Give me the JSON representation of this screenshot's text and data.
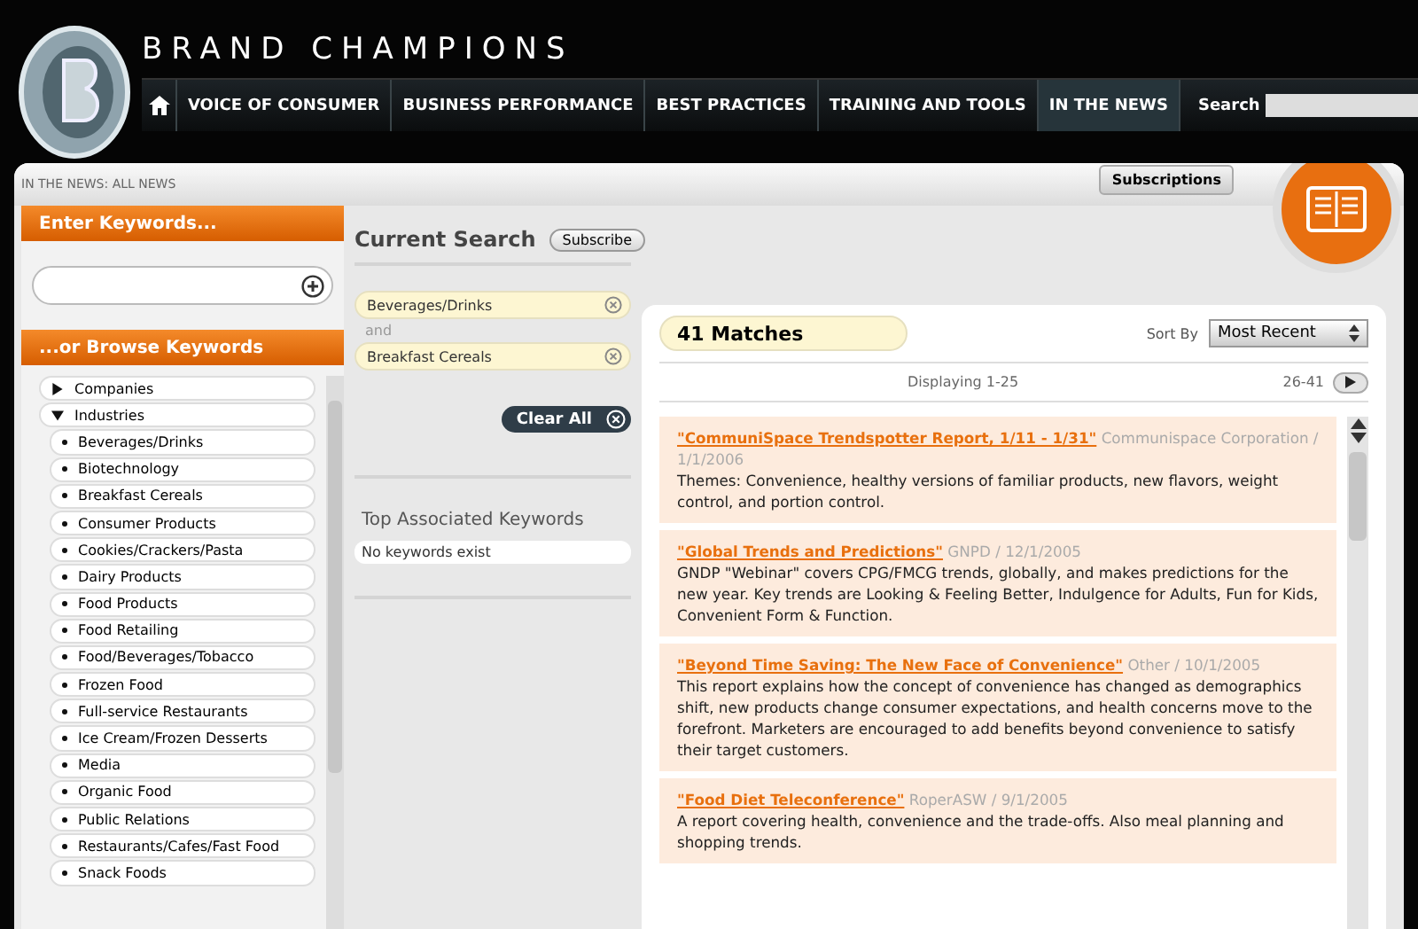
{
  "brand": {
    "name": "BRAND CHAMPIONS"
  },
  "nav": {
    "items": [
      {
        "label": "VOICE OF CONSUMER",
        "selected": false
      },
      {
        "label": "BUSINESS PERFORMANCE",
        "selected": false
      },
      {
        "label": "BEST PRACTICES",
        "selected": false
      },
      {
        "label": "TRAINING AND TOOLS",
        "selected": false
      },
      {
        "label": "IN THE NEWS",
        "selected": true
      }
    ],
    "search_label": "Search"
  },
  "breadcrumb": "IN THE NEWS: ALL NEWS",
  "subscriptions_button": "Subscriptions",
  "sidebar": {
    "keywords_heading": "Enter Keywords...",
    "browse_heading": "...or Browse Keywords",
    "tree": [
      {
        "label": "Companies",
        "expanded": false
      },
      {
        "label": "Industries",
        "expanded": true,
        "children": [
          {
            "label": "Beverages/Drinks"
          },
          {
            "label": "Biotechnology"
          },
          {
            "label": "Breakfast Cereals"
          },
          {
            "label": "Consumer Products"
          },
          {
            "label": "Cookies/Crackers/Pasta"
          },
          {
            "label": "Dairy Products"
          },
          {
            "label": "Food Products"
          },
          {
            "label": "Food Retailing"
          },
          {
            "label": "Food/Beverages/Tobacco"
          },
          {
            "label": "Frozen Food"
          },
          {
            "label": "Full-service Restaurants"
          },
          {
            "label": "Ice Cream/Frozen Desserts"
          },
          {
            "label": "Media"
          },
          {
            "label": "Organic Food"
          },
          {
            "label": "Public Relations"
          },
          {
            "label": "Restaurants/Cafes/Fast Food"
          },
          {
            "label": "Snack Foods"
          }
        ]
      }
    ]
  },
  "current_search": {
    "title": "Current Search",
    "subscribe_button": "Subscribe",
    "terms": [
      "Beverages/Drinks",
      "Breakfast Cereals"
    ],
    "connector": "and",
    "clear_button": "Clear All",
    "associated_title": "Top Associated Keywords",
    "associated_empty": "No keywords exist"
  },
  "results": {
    "count": "41 Matches",
    "sort_label": "Sort By",
    "sort_value": "Most Recent",
    "displaying": "Displaying 1-25",
    "next_range": "26-41",
    "items": [
      {
        "title": "\"CommuniSpace Trendspotter Report, 1/11 - 1/31\"",
        "meta": "Communispace Corporation / 1/1/2006",
        "body": "Themes:  Convenience, healthy versions of familiar products, new flavors, weight control, and portion control."
      },
      {
        "title": "\"Global Trends and Predictions\"",
        "meta": "GNPD / 12/1/2005",
        "body": "GNDP \"Webinar\" covers CPG/FMCG trends, globally, and makes predictions for the new year.  Key trends are Looking & Feeling Better, Indulgence for Adults, Fun for Kids, Convenient Form & Function."
      },
      {
        "title": "\"Beyond Time Saving: The New Face of Convenience\"",
        "meta": "Other / 10/1/2005",
        "body": "This report explains how the  concept of convenience has changed as demographics shift, new products change consumer expectations, and health concerns move to the forefront.  Marketers are encouraged to add benefits beyond convenience to satisfy their target customers."
      },
      {
        "title": "\"Food Diet Teleconference\"",
        "meta": "RoperASW / 9/1/2005",
        "body": "A report covering health, convenience and the trade-offs.  Also meal planning and shopping trends."
      }
    ]
  }
}
